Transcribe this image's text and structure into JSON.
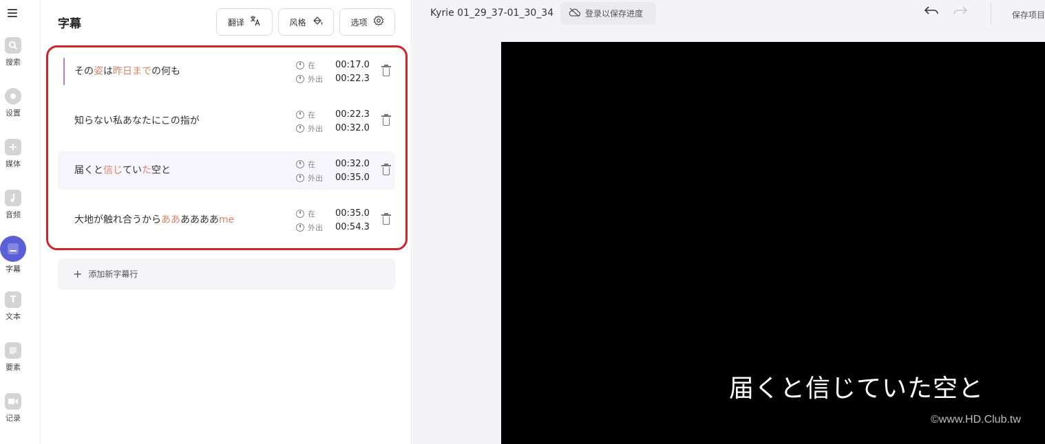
{
  "rail": {
    "items": [
      {
        "label": "搜索",
        "icon": "search-icon"
      },
      {
        "label": "设置",
        "icon": "settings-icon"
      },
      {
        "label": "媒体",
        "icon": "plus-icon"
      },
      {
        "label": "音频",
        "icon": "music-icon"
      },
      {
        "label": "字幕",
        "icon": "subtitles-icon",
        "active": true
      },
      {
        "label": "文本",
        "icon": "text-icon"
      },
      {
        "label": "要素",
        "icon": "sticker-icon"
      },
      {
        "label": "记录",
        "icon": "record-icon"
      }
    ]
  },
  "panel": {
    "title": "字幕",
    "translate_label": "翻译",
    "style_label": "风格",
    "options_label": "选项",
    "in_label": "在",
    "out_label": "外出",
    "add_row_label": "添加新字幕行",
    "rows": [
      {
        "pre": "その",
        "h1": "姿",
        "mid": "は",
        "h2": "昨日まで",
        "post": "の何も",
        "in": "00:17.0",
        "out": "00:22.3"
      },
      {
        "pre": "知らない私あなたにこの指が",
        "h1": "",
        "mid": "",
        "h2": "",
        "post": "",
        "in": "00:22.3",
        "out": "00:32.0"
      },
      {
        "pre": "届くと",
        "h1": "信じ",
        "mid": "てい",
        "h2": "た",
        "post": "空と",
        "in": "00:32.0",
        "out": "00:35.0"
      },
      {
        "pre": "大地が触れ合うから",
        "h1": "ああ",
        "mid": "ああああ",
        "h2": "me",
        "post": "",
        "in": "00:35.0",
        "out": "00:54.3"
      }
    ]
  },
  "header": {
    "project_name": "Kyrie 01_29_37-01_30_34",
    "login_label": "登录以保存进度",
    "save_label": "保存项目"
  },
  "video": {
    "caption": "届くと信じていた空と",
    "watermark": "©www.HD.Club.tw"
  },
  "colors": {
    "accent": "#5b5fd6",
    "highlight_text": "#d9826a",
    "frame": "#d0232a"
  }
}
